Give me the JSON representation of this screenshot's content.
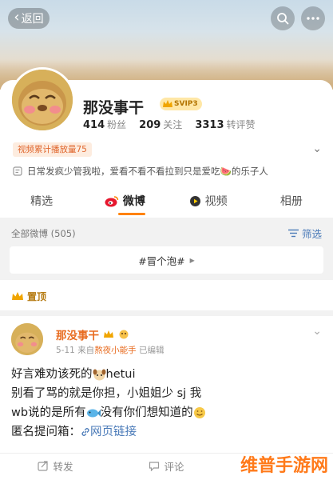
{
  "header": {
    "back_label": "返回"
  },
  "profile": {
    "name": "那没事干",
    "vip_badge": "SVIP3",
    "stats": [
      {
        "value": "414",
        "label": "粉丝"
      },
      {
        "value": "209",
        "label": "关注"
      },
      {
        "value": "3313",
        "label": "转评赞"
      }
    ],
    "plays_label": "视频累计播放量75",
    "bio": "日常发疯少管我啦，爱看不看不看拉到只是爱吃🍉的乐子人"
  },
  "tabs": [
    {
      "label": "精选"
    },
    {
      "label": "微博"
    },
    {
      "label": "视频"
    },
    {
      "label": "相册"
    }
  ],
  "feed": {
    "all_label": "全部微博 (505)",
    "filter_label": "筛选",
    "topic_label": "#冒个泡#",
    "pinned_label": "置顶"
  },
  "post": {
    "name": "那没事干",
    "date": "5-11",
    "source_prefix": "来自",
    "source": "熬夜小能手",
    "edited": "已编辑",
    "line1_text": "好言难劝该死的",
    "line1_tail": "hetui",
    "line2": "别看了骂的就是你担，小姐姐少 sj 我",
    "line3_head": "wb说的是所有",
    "line3_tail": "没有你们想知道的",
    "line4_head": "匿名提问箱：",
    "line4_link": "网页链接"
  },
  "actions": [
    {
      "label": "转发"
    },
    {
      "label": "评论"
    }
  ],
  "watermark": "维普手游网",
  "colors": {
    "accent": "#ff8200",
    "link": "#4a7ab8",
    "name": "#e86b1f"
  }
}
